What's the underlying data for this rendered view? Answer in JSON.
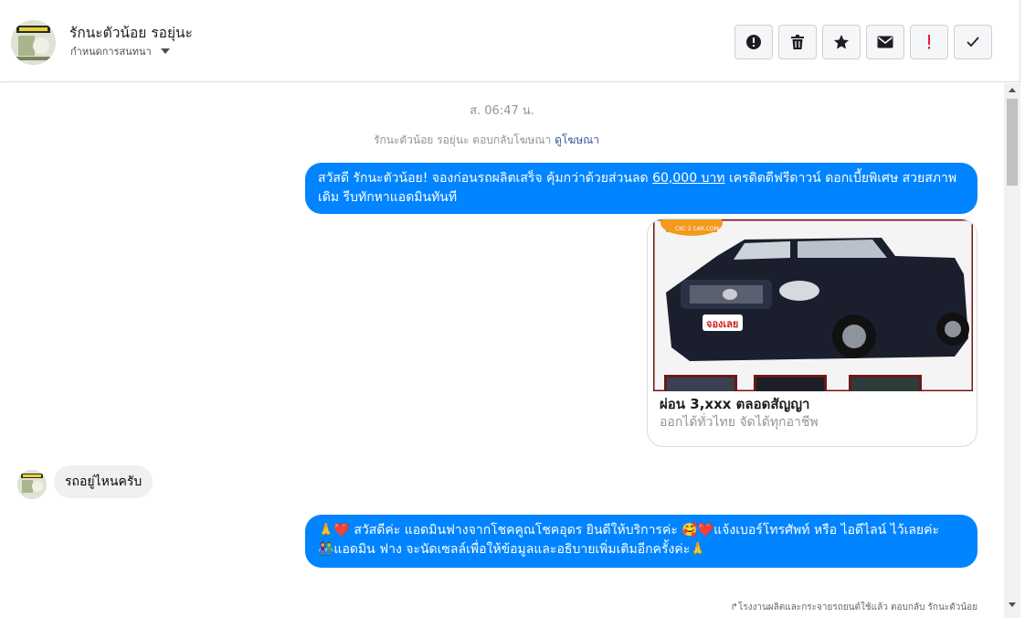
{
  "header": {
    "contact_name": "รักนะตัวน้อย รอยุ่นะ",
    "assign_label": "กำหนดการสนทนา"
  },
  "actions": [
    {
      "name": "spam-button",
      "icon": "alert-circle-icon"
    },
    {
      "name": "delete-button",
      "icon": "trash-icon"
    },
    {
      "name": "star-button",
      "icon": "star-icon"
    },
    {
      "name": "mark-unread-button",
      "icon": "envelope-icon"
    },
    {
      "name": "follow-up-button",
      "icon": "exclamation-icon"
    },
    {
      "name": "done-button",
      "icon": "check-icon"
    }
  ],
  "conversation": {
    "timestamp": "ส. 06:47 น.",
    "system_note_prefix": "รักนะตัวน้อย รอยุ่นะ ตอบกลับโฆษณา",
    "system_note_link": "ดูโฆษณา",
    "msg1_part1": "สวัสดี รักนะตัวน้อย! จองก่อนรถผลิตเสร็จ คุ้มกว่าด้วยส่วนลด ",
    "msg1_link": "60,000 บาท",
    "msg1_part2": " เครดิตดีฟรีดาวน์ ดอกเบี้ยพิเศษ สวยสภาพเดิม รีบทักหาแอดมินทันที",
    "card_title": "ผ่อน 3,xxx ตลอดสัญญา",
    "card_subtitle": "ออกได้ทั่วไทย จัดได้ทุกอาชีพ",
    "card_logo_text": "CKC 2 CAR.COM",
    "card_badge_text": "จองเลย",
    "incoming_msg": "รถอยู่ไหนครับ",
    "msg2_line1": "🙏❤️ สวัสดีค่ะ แอดมินฟางจากโชคคูณโชคอุดร ยินดีให้บริการค่ะ  🥰❤️แจ้งเบอร์โทรศัพท์ หรือ ไอดีไลน์  ไว้เลยค่ะ",
    "msg2_line2": "👫แอดมิน ฟาง จะนัดเซลล์เพื่อให้ข้อมูลและอธิบายเพิ่มเติมอีกครั้งค่ะ🙏",
    "footer_note": "↱โรงงานผลิตและกระจายรถยนต์ใช้แล้ว ตอบกลับ รักนะตัวน้อย"
  },
  "colors": {
    "outgoing_bubble": "#0084ff",
    "incoming_bubble": "#f1f0f0",
    "follow_up_icon": "#e41e3f"
  }
}
